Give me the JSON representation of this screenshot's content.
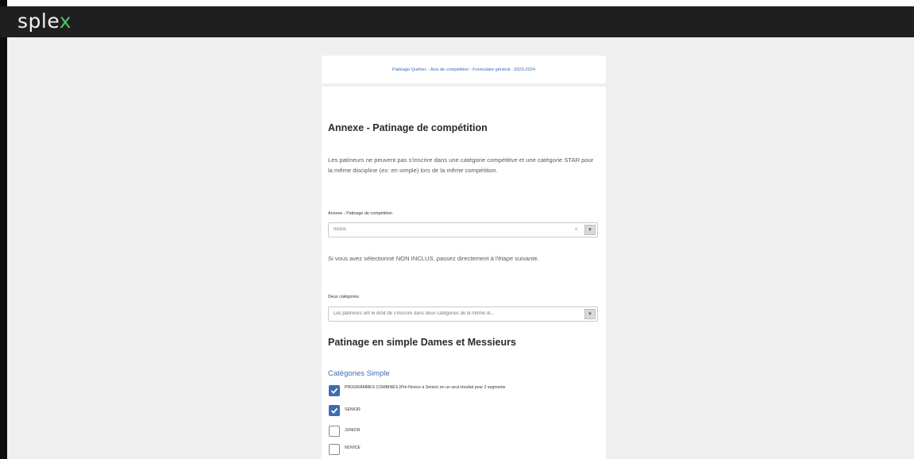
{
  "app": {
    "logo_main": "sple",
    "logo_accent": "x"
  },
  "form_header": {
    "title": "Patinage Québec - Avis de compétition - Formulaire général - 2023-2024"
  },
  "annexe": {
    "heading": "Annexe - Patinage de compétition",
    "intro": "Les patineurs ne peuvent pas s'inscrire dans une catégorie compétitive et une catégorie STAR pour la même discipline (ex: en simple) lors de la même compétition.",
    "select_label": "Annexe - Patinage de compétition",
    "select_value": "Inclus",
    "note": "Si vous avez sélectionné NON INCLUS, passez directement à l'étape suivante."
  },
  "deux_categories": {
    "label": "Deux catégories",
    "value": "Les patineurs ont le droit de s'inscrire dans deux catégories de la même di..."
  },
  "simple": {
    "heading": "Patinage en simple Dames et Messieurs",
    "section_title": "Catégories Simple",
    "options": [
      {
        "label": "PROGRAMMES COMBINÉS (Pré-Novice à Senior) en un seul résultat pour 2 segments",
        "checked": true
      },
      {
        "label": "SENIOR",
        "checked": true
      },
      {
        "label": "JUNIOR",
        "checked": false
      },
      {
        "label": "NOVICE",
        "checked": false
      }
    ]
  },
  "colors": {
    "accent": "#3d6cb0",
    "logo_green": "#48c46b",
    "topbar": "#1f1f1f",
    "background": "#efefef"
  },
  "icons": {
    "clear": "×",
    "dropdown": "chevron-down-icon"
  }
}
